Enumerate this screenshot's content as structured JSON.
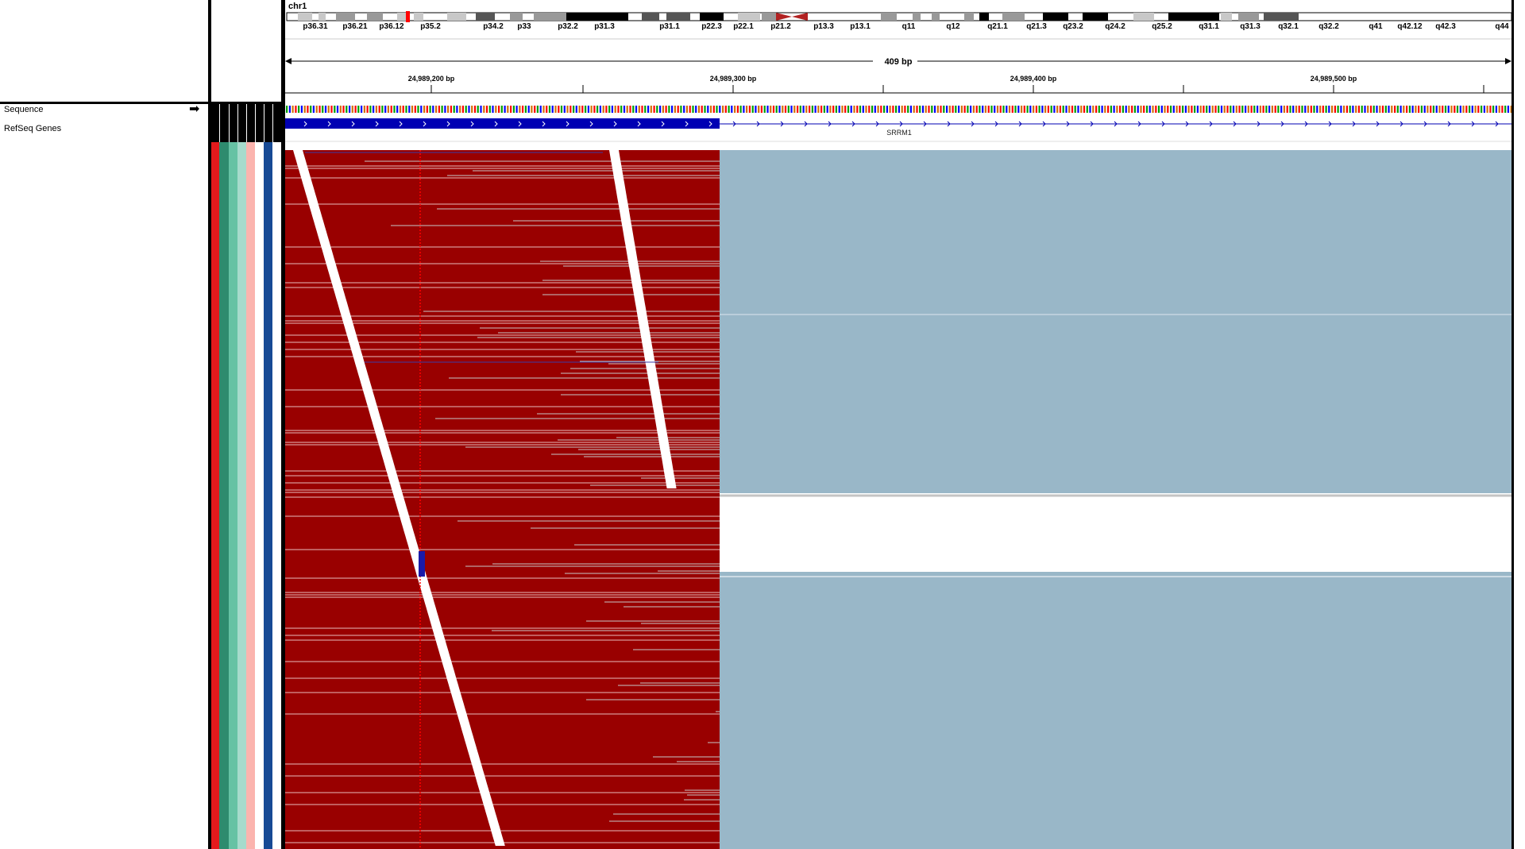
{
  "chromosome": {
    "name": "chr1",
    "bands": [
      "p36.31",
      "p36.21",
      "p36.12",
      "p35.2",
      "p34.2",
      "p33",
      "p32.2",
      "p31.3",
      "p31.1",
      "p22.3",
      "p22.1",
      "p21.2",
      "p13.3",
      "p13.1",
      "q11",
      "q12",
      "q21.1",
      "q21.3",
      "q23.2",
      "q24.2",
      "q25.2",
      "q31.1",
      "q31.3",
      "q32.1",
      "q32.2",
      "q41",
      "q42.12",
      "q42.3",
      "q44"
    ]
  },
  "ruler": {
    "span_label": "409 bp",
    "ticks": [
      "24,989,200 bp",
      "24,989,300 bp",
      "24,989,400 bp",
      "24,989,500 bp"
    ]
  },
  "tracks": {
    "sequence_label": "Sequence",
    "sequence_arrow": "➡",
    "genes_label": "RefSeq Genes",
    "gene_name": "SRRM1"
  },
  "colors": {
    "read_fill": "#990000",
    "soft_region": "#99b7c8",
    "gene_blue": "#0000b3",
    "mismatch_line": "#ff0000",
    "attr_strips": [
      "#e41a1c",
      "#2e8b6e",
      "#66c2a4",
      "#a6dbcc",
      "#fbb4ae",
      "#ffffff",
      "#174a95",
      "#ffffff"
    ]
  }
}
